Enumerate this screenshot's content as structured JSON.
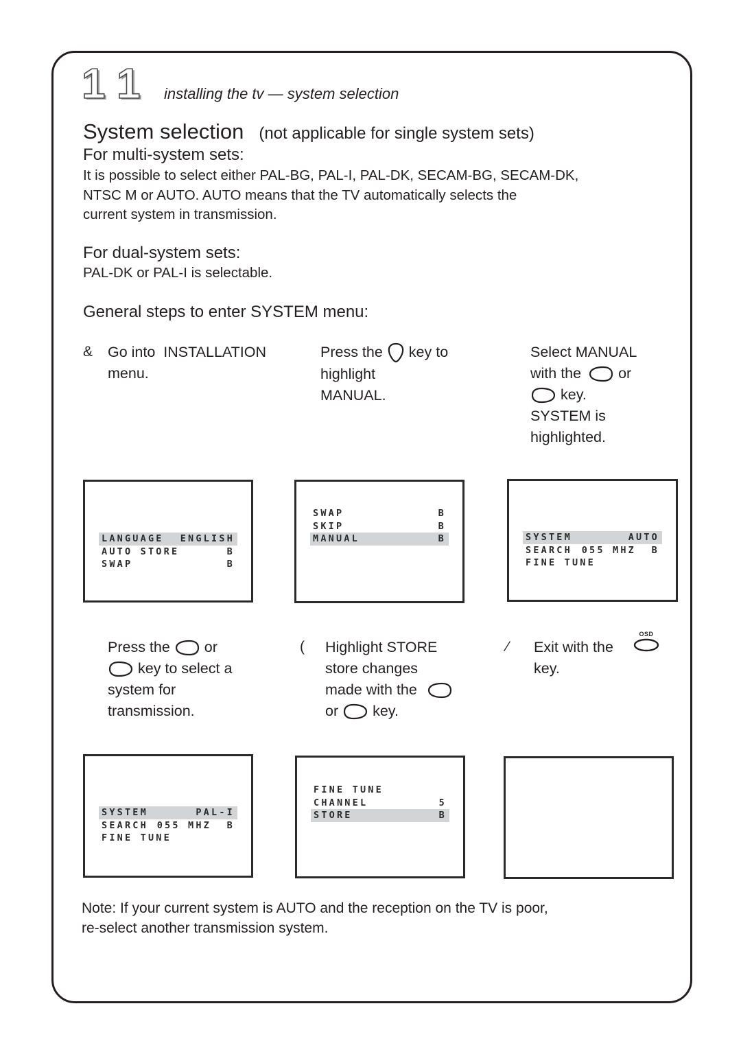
{
  "header": {
    "page_number_digits": [
      "1",
      "1"
    ],
    "chapter": "installing the tv — system selection"
  },
  "title": {
    "main": "System selection",
    "sub": "(not applicable for single system sets)"
  },
  "multi_system": {
    "heading": "For multi-system sets:",
    "lines": [
      "It is possible to select either PAL-BG, PAL-I, PAL-DK, SECAM-BG, SECAM-DK,",
      "NTSC M or AUTO.  AUTO means that the TV automatically selects the",
      "current system in transmission."
    ]
  },
  "dual_system": {
    "heading": "For dual-system sets:",
    "text": "PAL-DK or PAL-I is selectable."
  },
  "general_steps_heading": "General steps to enter SYSTEM menu:",
  "steps": [
    {
      "marker": "&",
      "lines": [
        "Go into  INSTALLATION",
        "menu."
      ]
    },
    {
      "marker": "",
      "line1_pre": "Press the",
      "line1_icon": "down-key-icon",
      "line1_post": "key to",
      "lines_rest": [
        "highlight",
        "MANUAL."
      ]
    },
    {
      "marker": "",
      "line1": "Select MANUAL",
      "line2_pre": "with the",
      "line2_icon": "left-key-icon",
      "line2_post": "or",
      "line3_icon": "right-key-icon",
      "line3_post": "key.",
      "lines_rest": [
        "SYSTEM is",
        "highlighted."
      ]
    },
    {
      "marker": "",
      "line1_pre": "Press the",
      "line1_icon": "left-key-icon",
      "line1_post": "or",
      "line2_icon": "right-key-icon",
      "line2_post": "key to select a",
      "lines_rest": [
        "system for",
        "transmission."
      ]
    },
    {
      "marker": "(",
      "lines_start": [
        "Highlight STORE",
        "store changes"
      ],
      "line3_pre": "made with the",
      "line3_icon": "left-key-icon",
      "line4_pre": "or",
      "line4_icon": "right-key-icon",
      "line4_post": "key."
    },
    {
      "marker": "⁄",
      "line1_pre": "Exit with the",
      "line1_icon": "osd-key-icon",
      "osd_label": "OSD",
      "line2": "key."
    }
  ],
  "screens": [
    {
      "rows": [
        {
          "label": "LANGUAGE",
          "value": "ENGLISH",
          "highlight": true
        },
        {
          "label": "AUTO STORE",
          "value": "B",
          "highlight": false
        },
        {
          "label": "SWAP",
          "value": "B",
          "highlight": false
        }
      ]
    },
    {
      "rows": [
        {
          "label": "SWAP",
          "value": "B",
          "highlight": false
        },
        {
          "label": "SKIP",
          "value": "B",
          "highlight": false
        },
        {
          "label": "MANUAL",
          "value": "B",
          "highlight": true
        }
      ]
    },
    {
      "rows": [
        {
          "label": "SYSTEM",
          "value": "AUTO",
          "highlight": true
        },
        {
          "label": "SEARCH",
          "value": "055 MHZ  B",
          "highlight": false
        },
        {
          "label": "FINE TUNE",
          "value": "",
          "highlight": false
        }
      ]
    },
    {
      "rows": [
        {
          "label": "SYSTEM",
          "value": "PAL-I",
          "highlight": true
        },
        {
          "label": "SEARCH",
          "value": "055 MHZ  B",
          "highlight": false
        },
        {
          "label": "FINE TUNE",
          "value": "",
          "highlight": false
        }
      ]
    },
    {
      "rows": [
        {
          "label": "FINE TUNE",
          "value": "",
          "highlight": false
        },
        {
          "label": "CHANNEL",
          "value": "5",
          "highlight": false
        },
        {
          "label": "STORE",
          "value": "B",
          "highlight": true
        }
      ]
    },
    {
      "rows": []
    }
  ],
  "note": {
    "lines": [
      "Note: If your current system is AUTO and the reception on the TV is poor,",
      "re-select another transmission system."
    ]
  },
  "colors": {
    "text": "#231f20",
    "highlight_bar": "#d3d4d5",
    "screen_border": "#2a2a2a"
  }
}
